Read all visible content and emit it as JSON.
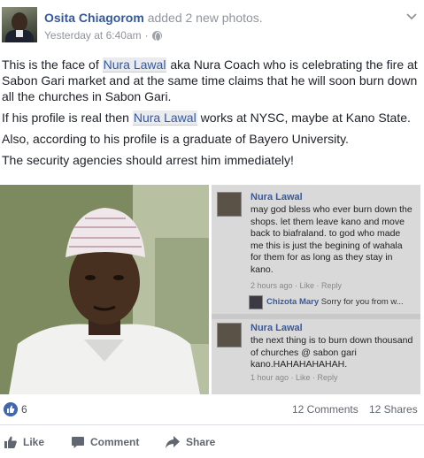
{
  "post": {
    "author": "Osita Chiagorom",
    "action_text": "added 2 new photos.",
    "timestamp": "Yesterday at 6:40am",
    "dot": "·",
    "paragraphs": {
      "p1_before": "This is the face of ",
      "p1_mention": "Nura Lawal",
      "p1_after": " aka Nura Coach who is celebrating the fire at Sabon Gari market and at the same time claims that he will soon burn down all the churches in Sabon Gari.",
      "p2_before": "If his profile is real then ",
      "p2_mention": "Nura Lawal",
      "p2_after": " works at NYSC, maybe at Kano State.",
      "p3": "Also, according to his profile is a graduate of Bayero University.",
      "p4": "The security agencies should arrest him immediately!"
    }
  },
  "photo_right": {
    "comment1": {
      "name": "Nura Lawal",
      "text": "may god bless who ever burn down the shops. let them leave kano and move back to biafraland. to god who made me this is just the begining of wahala for them for as long as they stay in kano.",
      "meta": "2 hours ago · Like · Reply"
    },
    "reply1": {
      "name": "Chizota Mary",
      "text": " Sorry for you from w..."
    },
    "comment2": {
      "name": "Nura Lawal",
      "text": "the next thing is to burn down thousand of churches @ sabon gari kano.HAHAHAHAHAH.",
      "meta": "1 hour ago · Like · Reply"
    }
  },
  "stats": {
    "likes": "6",
    "comments": "12 Comments",
    "shares": "12 Shares"
  },
  "actions": {
    "like": "Like",
    "comment": "Comment",
    "share": "Share"
  },
  "colors": {
    "link": "#365899",
    "like_blue": "#4267b2",
    "muted": "#90949c"
  },
  "icons": [
    "globe-icon",
    "chevron-down-icon",
    "like-badge-icon",
    "thumbs-up-icon",
    "comment-icon",
    "share-icon"
  ]
}
